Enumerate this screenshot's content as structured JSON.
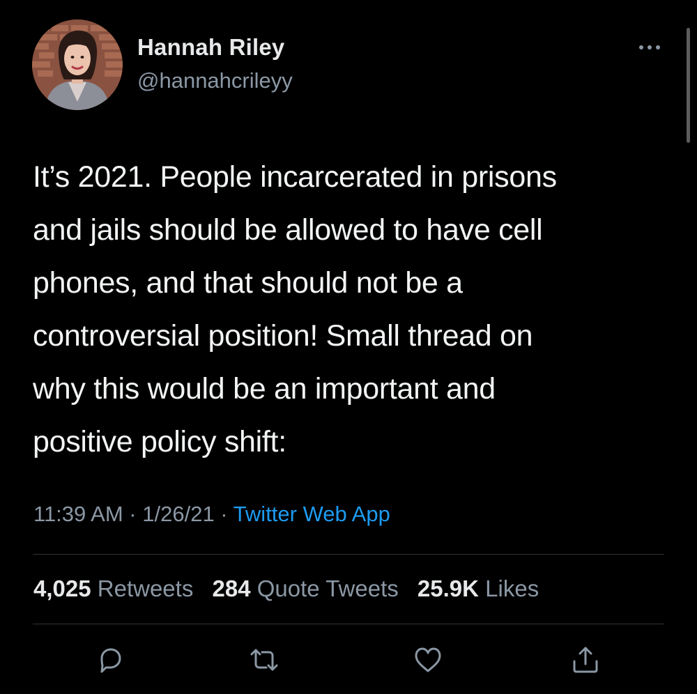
{
  "author": {
    "name": "Hannah Riley",
    "handle": "@hannahcrileyy"
  },
  "tweet": {
    "text_lines": [
      "It’s 2021. People incarcerated in prisons",
      "and jails should be allowed to have cell",
      "phones, and that should not be a",
      "controversial position! Small thread on",
      "why this would be an important and",
      "positive policy shift:"
    ],
    "time": "11:39 AM",
    "date": "1/26/21",
    "separator": " · ",
    "source": "Twitter Web App"
  },
  "stats": {
    "retweets_count": "4,025",
    "retweets_label": "Retweets",
    "quotes_count": "284",
    "quotes_label": "Quote Tweets",
    "likes_count": "25.9K",
    "likes_label": "Likes"
  },
  "icons": {
    "more": "more-icon",
    "reply": "reply-icon",
    "retweet": "retweet-icon",
    "like": "heart-icon",
    "share": "share-icon"
  },
  "colors": {
    "background": "#000000",
    "text": "#e7e9ea",
    "secondary": "#8b98a5",
    "link": "#1d9bf0",
    "divider": "#2f3336"
  }
}
